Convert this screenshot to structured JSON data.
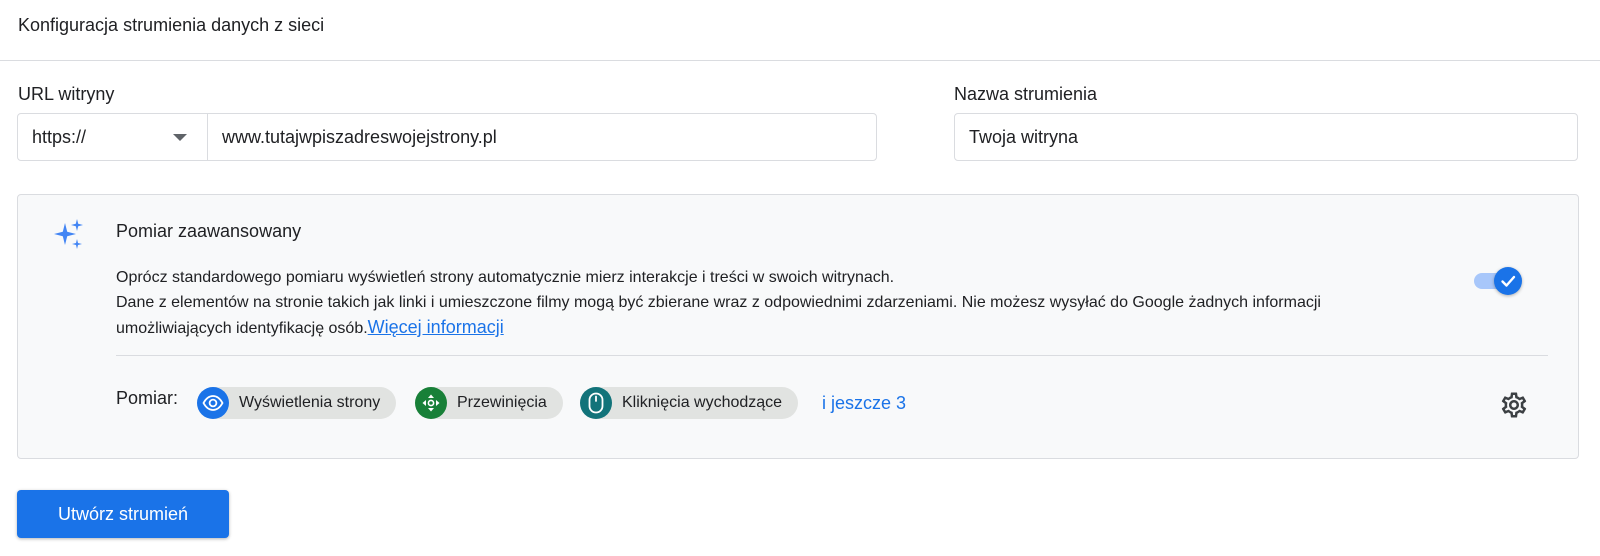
{
  "header": {
    "title": "Konfiguracja strumienia danych z sieci"
  },
  "url_field": {
    "label": "URL witryny",
    "protocol": "https://",
    "value": "www.tutajwpiszadreswojejstrony.pl"
  },
  "name_field": {
    "label": "Nazwa strumienia",
    "value": "Twoja witryna"
  },
  "enhanced": {
    "icon": "sparkle-icon",
    "title": "Pomiar zaawansowany",
    "desc_line1": "Oprócz standardowego pomiaru wyświetleń strony automatycznie mierz interakcje i treści w swoich witrynach.",
    "desc_line2": "Dane z elementów na stronie takich jak linki i umieszczone filmy mogą być zbierane wraz z odpowiednimi zdarzeniami. Nie możesz wysyłać do Google żadnych informacji",
    "desc_line3": "umożliwiających identyfikację osób.",
    "more_link": "Więcej informacji",
    "toggle_on": true,
    "measure_label": "Pomiar:",
    "chips": [
      {
        "label": "Wyświetlenia strony",
        "icon": "eye-icon",
        "color": "#1a73e8"
      },
      {
        "label": "Przewinięcia",
        "icon": "scroll-arrows-icon",
        "color": "#188038"
      },
      {
        "label": "Kliknięcia wychodzące",
        "icon": "mouse-icon",
        "color": "#12737a"
      }
    ],
    "more_chips": "i jeszcze 3",
    "settings_icon": "gear-icon"
  },
  "actions": {
    "create_label": "Utwórz strumień"
  },
  "colors": {
    "accent": "#1a73e8",
    "card_bg": "#f8f9fa",
    "border": "#dadce0",
    "chip_bg": "#e1e3e1"
  }
}
